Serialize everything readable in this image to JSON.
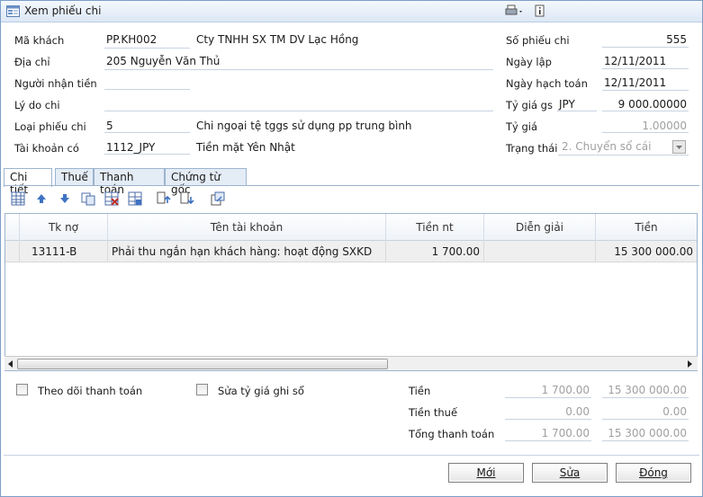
{
  "window": {
    "title": "Xem phiếu chi"
  },
  "header": {
    "ma_khach_label": "Mã khách",
    "ma_khach": "PP.KH002",
    "ten_khach": "Cty TNHH SX TM DV Lạc Hồng",
    "dia_chi_label": "Địa chỉ",
    "dia_chi": "205 Nguyễn Văn Thủ",
    "nguoi_nhan_label": "Người nhận tiền",
    "nguoi_nhan": "",
    "ly_do_label": "Lý do chi",
    "ly_do": "",
    "loai_phieu_label": "Loại phiếu chi",
    "loai_phieu": "5",
    "loai_phieu_ten": "Chi ngoại tệ tggs sử dụng pp trung bình",
    "tai_khoan_label": "Tài khoản có",
    "tai_khoan": "1112_JPY",
    "tai_khoan_ten": "Tiền mặt Yên Nhật",
    "so_phieu_label": "Số phiếu chi",
    "so_phieu": "555",
    "ngay_lap_label": "Ngày lập",
    "ngay_lap": "12/11/2011",
    "ngay_hach_toan_label": "Ngày hạch toán",
    "ngay_hach_toan": "12/11/2011",
    "ty_gia_gs_label": "Tỷ giá gs",
    "currency": "JPY",
    "ty_gia_gs": "9 000.00000",
    "ty_gia_label": "Tỷ giá",
    "ty_gia": "1.00000",
    "trang_thai_label": "Trạng thái",
    "trang_thai": "2. Chuyển sổ cái"
  },
  "tabs": [
    {
      "label": "Chi tiết"
    },
    {
      "label": "Thuế"
    },
    {
      "label": "Thanh toán"
    },
    {
      "label": "Chứng từ gốc"
    }
  ],
  "grid": {
    "columns": [
      "Tk nợ",
      "Tên tài khoản",
      "Tiền nt",
      "Diễn giải",
      "Tiền"
    ],
    "rows": [
      {
        "tk_no": "13111-B",
        "ten_tk": "Phải thu ngắn hạn khách hàng: hoạt động SXKD",
        "tien_nt": "1 700.00",
        "dien_giai": "",
        "tien": "15 300 000.00"
      }
    ]
  },
  "footer": {
    "theo_doi_label": "Theo dõi thanh toán",
    "sua_ty_gia_label": "Sửa tỷ giá ghi sổ",
    "tien_label": "Tiền",
    "tien_nt": "1 700.00",
    "tien": "15 300 000.00",
    "tien_thue_label": "Tiền thuế",
    "tien_thue_nt": "0.00",
    "tien_thue": "0.00",
    "tong_label": "Tổng thanh toán",
    "tong_nt": "1 700.00",
    "tong": "15 300 000.00"
  },
  "buttons": {
    "moi": "Mới",
    "sua": "Sửa",
    "dong": "Đóng"
  },
  "colors": {
    "accent": "#9db3cf",
    "grey_text": "#a0a0a0"
  }
}
